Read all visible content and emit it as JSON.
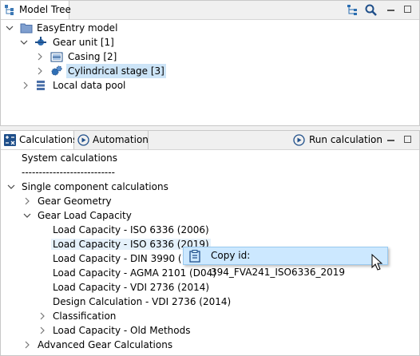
{
  "model_tree": {
    "tab_label": "Model Tree",
    "items": [
      {
        "label": "EasyEntry model"
      },
      {
        "label": "Gear unit [1]"
      },
      {
        "label": "Casing [2]"
      },
      {
        "label": "Cylindrical stage [3]"
      },
      {
        "label": "Local data pool"
      }
    ]
  },
  "calc_panel": {
    "tabs": [
      {
        "label": "Calculations"
      },
      {
        "label": "Automation"
      }
    ],
    "run_label": "Run calculation",
    "items": [
      {
        "label": "System calculations"
      },
      {
        "label": "---------------------------"
      },
      {
        "label": "Single component calculations"
      },
      {
        "label": "Gear Geometry"
      },
      {
        "label": "Gear Load Capacity"
      },
      {
        "label": "Load Capacity - ISO 6336 (2006)"
      },
      {
        "label": "Load Capacity - ISO 6336 (2019)"
      },
      {
        "label": "Load Capacity - DIN 3990 (1987)"
      },
      {
        "label": "Load Capacity - AGMA 2101 (D04)"
      },
      {
        "label": "Load Capacity - VDI 2736 (2014)"
      },
      {
        "label": "Design Calculation - VDI 2736 (2014)"
      },
      {
        "label": "Classification"
      },
      {
        "label": "Load Capacity - Old Methods"
      },
      {
        "label": "Advanced Gear Calculations"
      }
    ]
  },
  "context_menu": {
    "copy_id_label": "Copy id: 394_FVA241_ISO6336_2019"
  }
}
